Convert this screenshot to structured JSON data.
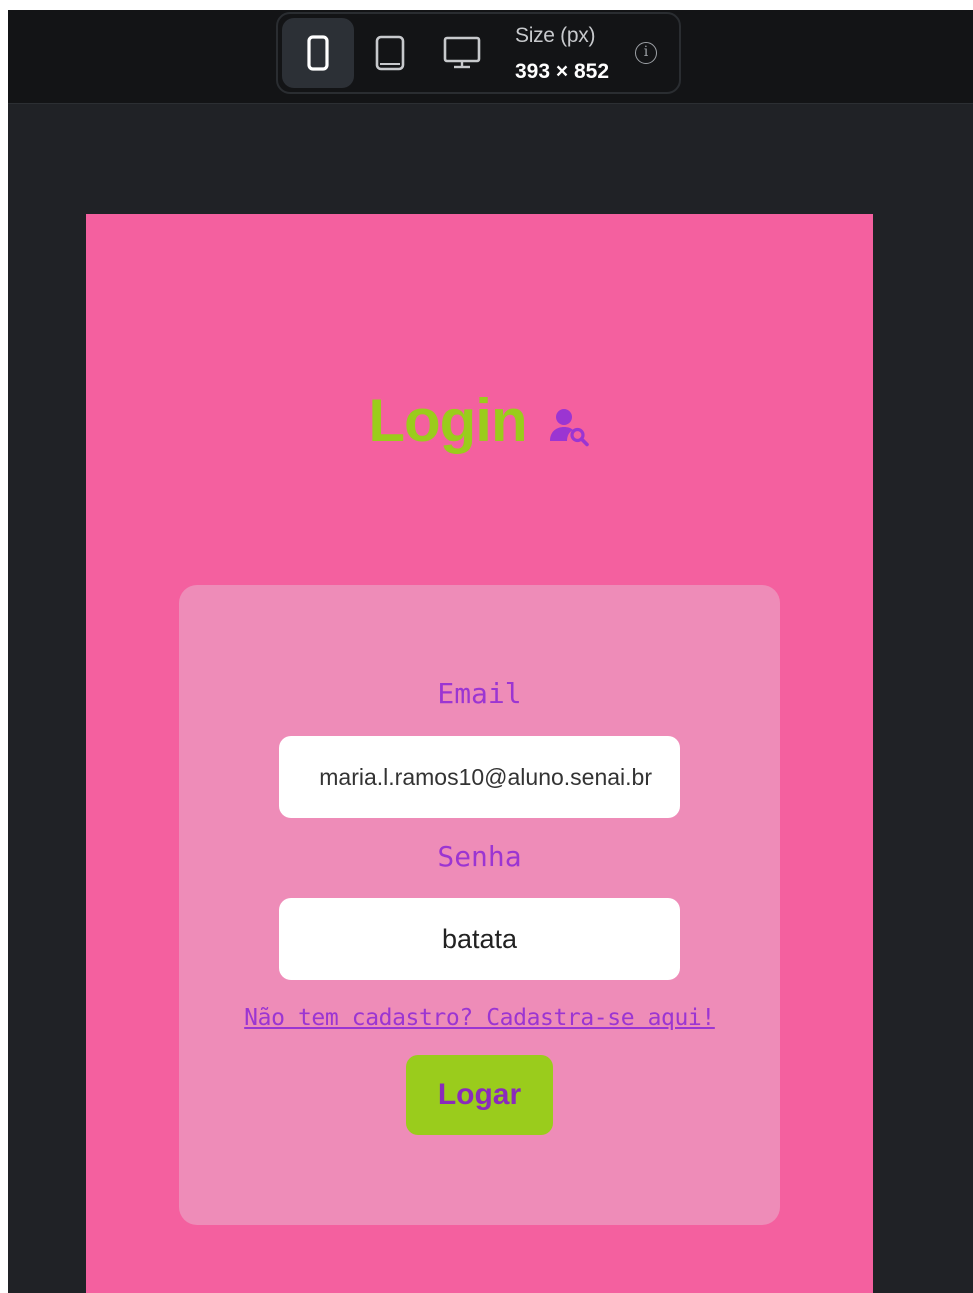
{
  "toolbar": {
    "devices": [
      "phone",
      "tablet",
      "desktop"
    ],
    "size_label": "Size (px)",
    "size_value": "393 × 852",
    "info_symbol": "i"
  },
  "page": {
    "title": "Login",
    "title_icon": "user-search-icon"
  },
  "form": {
    "email_label": "Email",
    "email_value": "maria.l.ramos10@aluno.senai.br",
    "password_label": "Senha",
    "password_value": "batata",
    "signup_link": "Não tem cadastro? Cadastra-se aqui!",
    "submit_label": "Logar"
  },
  "colors": {
    "page_bg": "#f4609f",
    "card_bg": "#ee8cb8",
    "title": "#9acc1c",
    "accent_purple": "#9b35d2",
    "button_bg": "#9acc1c"
  }
}
